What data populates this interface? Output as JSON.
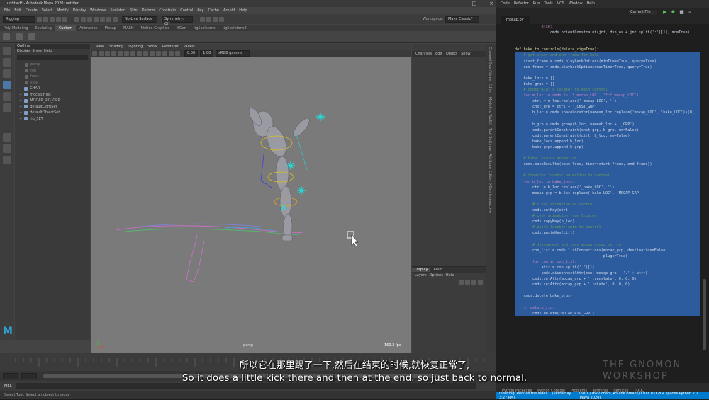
{
  "maya": {
    "title": "untitled* - Autodesk Maya 2020: untitled",
    "menu": [
      "File",
      "Edit",
      "Create",
      "Select",
      "Modify",
      "Display",
      "Windows",
      "Skeleton",
      "Skin",
      "Deform",
      "Constrain",
      "Control",
      "Key",
      "Cache",
      "Arnold",
      "Help"
    ],
    "mode": "Rigging",
    "no_live_surface": "No Live Surface",
    "symmetry": "Symmetry: Off",
    "workspace_label": "Workspace:",
    "workspace_value": "Maya Classic*",
    "shelf_tabs": [
      "Poly Modeling",
      "Sculpting",
      "Custom",
      "Animation",
      "Mocap",
      "MASH",
      "Motion Graphics",
      "XGen",
      "rigSkeletons",
      "rigSkeletons2"
    ],
    "active_shelf": "Custom",
    "outliner": {
      "title": "Outliner",
      "menu": [
        "Display",
        "Show",
        "Help"
      ],
      "items": [
        {
          "label": "persp",
          "dim": true
        },
        {
          "label": "top",
          "dim": true
        },
        {
          "label": "front",
          "dim": true
        },
        {
          "label": "side",
          "dim": true
        },
        {
          "label": "CHAR",
          "dim": false
        },
        {
          "label": "mocap:Hips",
          "dim": false
        },
        {
          "label": "MOCAP_RIG_GRP",
          "dim": false
        },
        {
          "label": "defaultLightSet",
          "dim": false
        },
        {
          "label": "defaultObjectSet",
          "dim": false
        },
        {
          "label": "rig_SET",
          "dim": false
        }
      ]
    },
    "viewport_menu": [
      "View",
      "Shading",
      "Lighting",
      "Show",
      "Renderer",
      "Panels"
    ],
    "viewport_camera": "persp",
    "fps": "160.3 fps",
    "gamma": "sRGB gamma",
    "exposure": "0.00",
    "gamma_value": "1.00",
    "channelbox_menu": [
      "Channels",
      "Edit",
      "Object",
      "Show"
    ],
    "layers_tabs": [
      "Display",
      "Anim"
    ],
    "layers_menu": [
      "Layers",
      "Options",
      "Help"
    ],
    "side_tabs": [
      "Channel Box / Layer Editor",
      "Modeling Toolkit",
      "Tool Settings",
      "Attribute Editor",
      "XGen Interactive"
    ],
    "cmd_label": "MEL",
    "help_line": "Select Tool: Select an object to move"
  },
  "vscode": {
    "menu": [
      "Code",
      "Refactor",
      "Run",
      "Tools",
      "VCS",
      "Window",
      "Help"
    ],
    "project": "Current File",
    "tab": "mocap.py",
    "code": [
      {
        "t": "            else:",
        "hl": false
      },
      {
        "t": "                cmds.orientConstraint(jnt, dvn_os + jnt.split(':')[1], mo=True)",
        "hl": false
      },
      {
        "t": "",
        "hl": false
      },
      {
        "t": "",
        "hl": false
      },
      {
        "t": "def bake_to_controls(delete_rig=True):",
        "hl": false
      },
      {
        "t": "    # get start and end frame for bake",
        "hl": true
      },
      {
        "t": "    start_frame = cmds.playbackOptions(minTime=True, query=True)",
        "hl": true
      },
      {
        "t": "    end_frame = cmds.playbackOptions(maxTime=True, query=True)",
        "hl": true
      },
      {
        "t": "",
        "hl": true
      },
      {
        "t": "    bake_locs = []",
        "hl": true
      },
      {
        "t": "    bake_grps = []",
        "hl": true
      },
      {
        "t": "    # constraint a locator to each control",
        "hl": true
      },
      {
        "t": "    for m_loc in cmds.ls('*_mocap_LOC', '*:*_mocap_LOC'):",
        "hl": true
      },
      {
        "t": "        ctrl = m_loc.replace('_mocap_LOC', '')",
        "hl": true
      },
      {
        "t": "        cnst_grp = ctrl + '_CNST_GRP'",
        "hl": true
      },
      {
        "t": "        b_loc = cmds.spaceLocator(name=m_loc.replace('mocap_LOC', 'bake_LOC'))[0]",
        "hl": true
      },
      {
        "t": "",
        "hl": true
      },
      {
        "t": "        b_grp = cmds.group(b_loc, name=b_loc + '_GRP')",
        "hl": true
      },
      {
        "t": "        cmds.parentConstraint(cnst_grp, b_grp, mo=False)",
        "hl": true
      },
      {
        "t": "        cmds.parentConstraint(ctrl, b_loc, mo=False)",
        "hl": true
      },
      {
        "t": "        bake_locs.append(b_loc)",
        "hl": true
      },
      {
        "t": "        bake_grps.append(b_grp)",
        "hl": true
      },
      {
        "t": "",
        "hl": true
      },
      {
        "t": "    # bake locator animation",
        "hl": true
      },
      {
        "t": "    cmds.bakeResults(bake_locs, time=(start_frame, end_frame))",
        "hl": true
      },
      {
        "t": "",
        "hl": true
      },
      {
        "t": "    # transfer locator animation to control",
        "hl": true
      },
      {
        "t": "    for b_loc in bake_locs:",
        "hl": true
      },
      {
        "t": "        ctrl = b_loc.replace('_bake_LOC', '')",
        "hl": true
      },
      {
        "t": "        mocap_grp = b_loc.replace('bake_LOC', 'MOCAP_GRP')",
        "hl": true
      },
      {
        "t": "",
        "hl": true
      },
      {
        "t": "        # clear animation on control",
        "hl": true
      },
      {
        "t": "        cmds.cutKey(ctrl)",
        "hl": true
      },
      {
        "t": "        # copy animation from locator",
        "hl": true
      },
      {
        "t": "        cmds.copyKey(b_loc)",
        "hl": true
      },
      {
        "t": "        # paste locator anim to control",
        "hl": true
      },
      {
        "t": "        cmds.pasteKey(ctrl)",
        "hl": true
      },
      {
        "t": "",
        "hl": true
      },
      {
        "t": "        # disconnect and zero mocap group on rig",
        "hl": true
      },
      {
        "t": "        con_list = cmds.listConnections(mocap_grp, destination=False,",
        "hl": true
      },
      {
        "t": "                                        plugs=True)",
        "hl": true
      },
      {
        "t": "        for con in con_list:",
        "hl": true
      },
      {
        "t": "            attr = con.split('.')[1]",
        "hl": true
      },
      {
        "t": "            cmds.disconnectAttr(con, mocap_grp + '.' + attr)",
        "hl": true
      },
      {
        "t": "        cmds.setAttr(mocap_grp + '.translate', 0, 0, 0)",
        "hl": true
      },
      {
        "t": "        cmds.setAttr(mocap_grp + '.rotate', 0, 0, 0)",
        "hl": true
      },
      {
        "t": "",
        "hl": true
      },
      {
        "t": "    cmds.delete(bake_grps)",
        "hl": true
      },
      {
        "t": "",
        "hl": true
      },
      {
        "t": "    if delete_rig:",
        "hl": true
      },
      {
        "t": "        cmds.delete('MOCAP_RIG_GRP')",
        "hl": true
      }
    ],
    "bottom_tabs": [
      "Python Packages",
      "Python Console",
      "Problems",
      "Terminal",
      "Services",
      "TODO"
    ],
    "status_left": "Indexing: Reduce the index... (yesterday 3:27 PM)",
    "status_right": "150:1 (1677 chars, 45 line breaks)   CRLF   UTF-8   4 spaces   Python 2.7 (Maya 2020)"
  },
  "subtitle": {
    "cn": "所以它在那里踢了一下,然后在结束的时候,就恢复正常了,",
    "en": "So it does a little kick there and then at the end. so just back to normal."
  },
  "watermark": "THE GNOMON WORKSHOP"
}
